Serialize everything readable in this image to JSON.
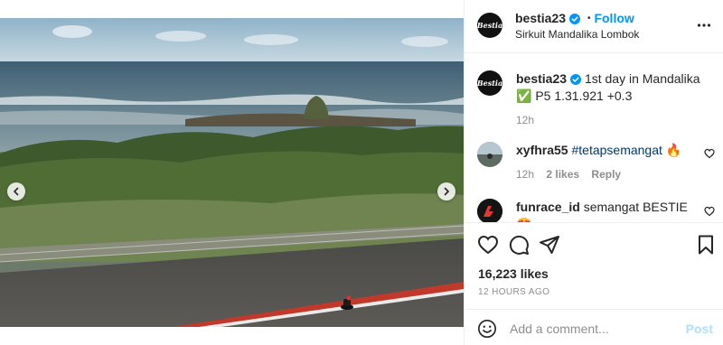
{
  "header": {
    "username": "bestia23",
    "follow_label": "Follow",
    "separator": "•",
    "location": "Sirkuit Mandalika Lombok",
    "avatar_text": "Bestia"
  },
  "caption": {
    "username": "bestia23",
    "text": "1st day in Mandalika ✅ P5 1.31.921 +0.3",
    "time": "12h"
  },
  "comments": [
    {
      "username": "xyfhra55",
      "hashtag": "#tetapsemangat",
      "emoji": "🔥",
      "time": "12h",
      "likes": "2 likes",
      "reply_label": "Reply"
    },
    {
      "username": "funrace_id",
      "text": "semangat BESTIE",
      "emoji": "😍"
    }
  ],
  "post": {
    "likes": "16,223 likes",
    "timestamp": "12 HOURS AGO"
  },
  "composer": {
    "placeholder": "Add a comment...",
    "post_label": "Post"
  },
  "carousel": {
    "slide_count": 3,
    "active_index": 1
  },
  "colors": {
    "link": "#0095f6",
    "verified": "#0095f6",
    "hashtag": "#00376b",
    "secondary": "#8e8e8e"
  }
}
